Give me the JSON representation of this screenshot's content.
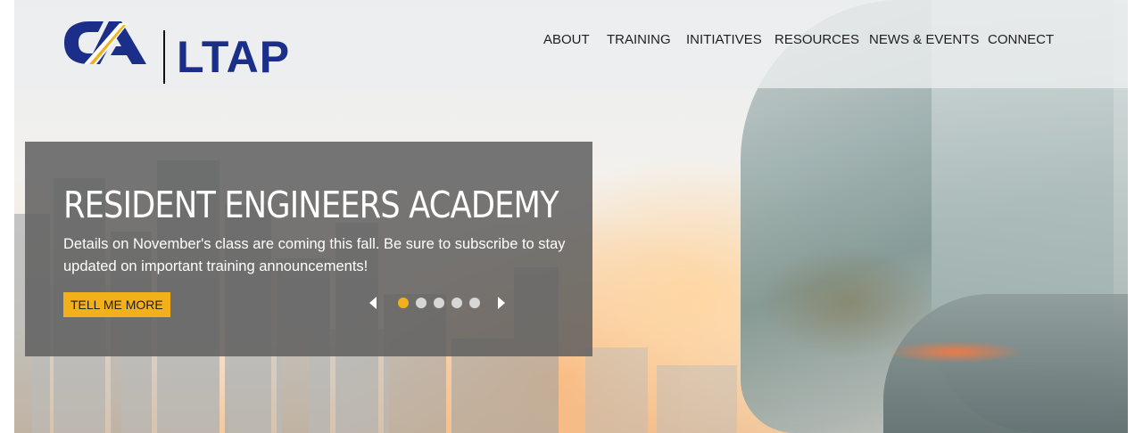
{
  "brand": {
    "logo_mark": "CA",
    "logo_text": "LTAP",
    "colors": {
      "navy": "#1b2f8a",
      "gold": "#f2b11a",
      "panel": "#606060"
    }
  },
  "nav": {
    "items": [
      {
        "label": "ABOUT"
      },
      {
        "label": "TRAINING"
      },
      {
        "label": "INITIATIVES"
      },
      {
        "label": "RESOURCES"
      },
      {
        "label": "NEWS & EVENTS"
      },
      {
        "label": "CONNECT"
      }
    ]
  },
  "slide": {
    "title": "RESIDENT ENGINEERS ACADEMY",
    "description": "Details on November's class are coming this fall. Be sure to subscribe to stay updated on important training announcements!",
    "cta_label": "TELL ME MORE"
  },
  "carousel": {
    "prev_icon": "triangle-left-icon",
    "next_icon": "triangle-right-icon",
    "slide_count": 5,
    "active_index": 0
  }
}
